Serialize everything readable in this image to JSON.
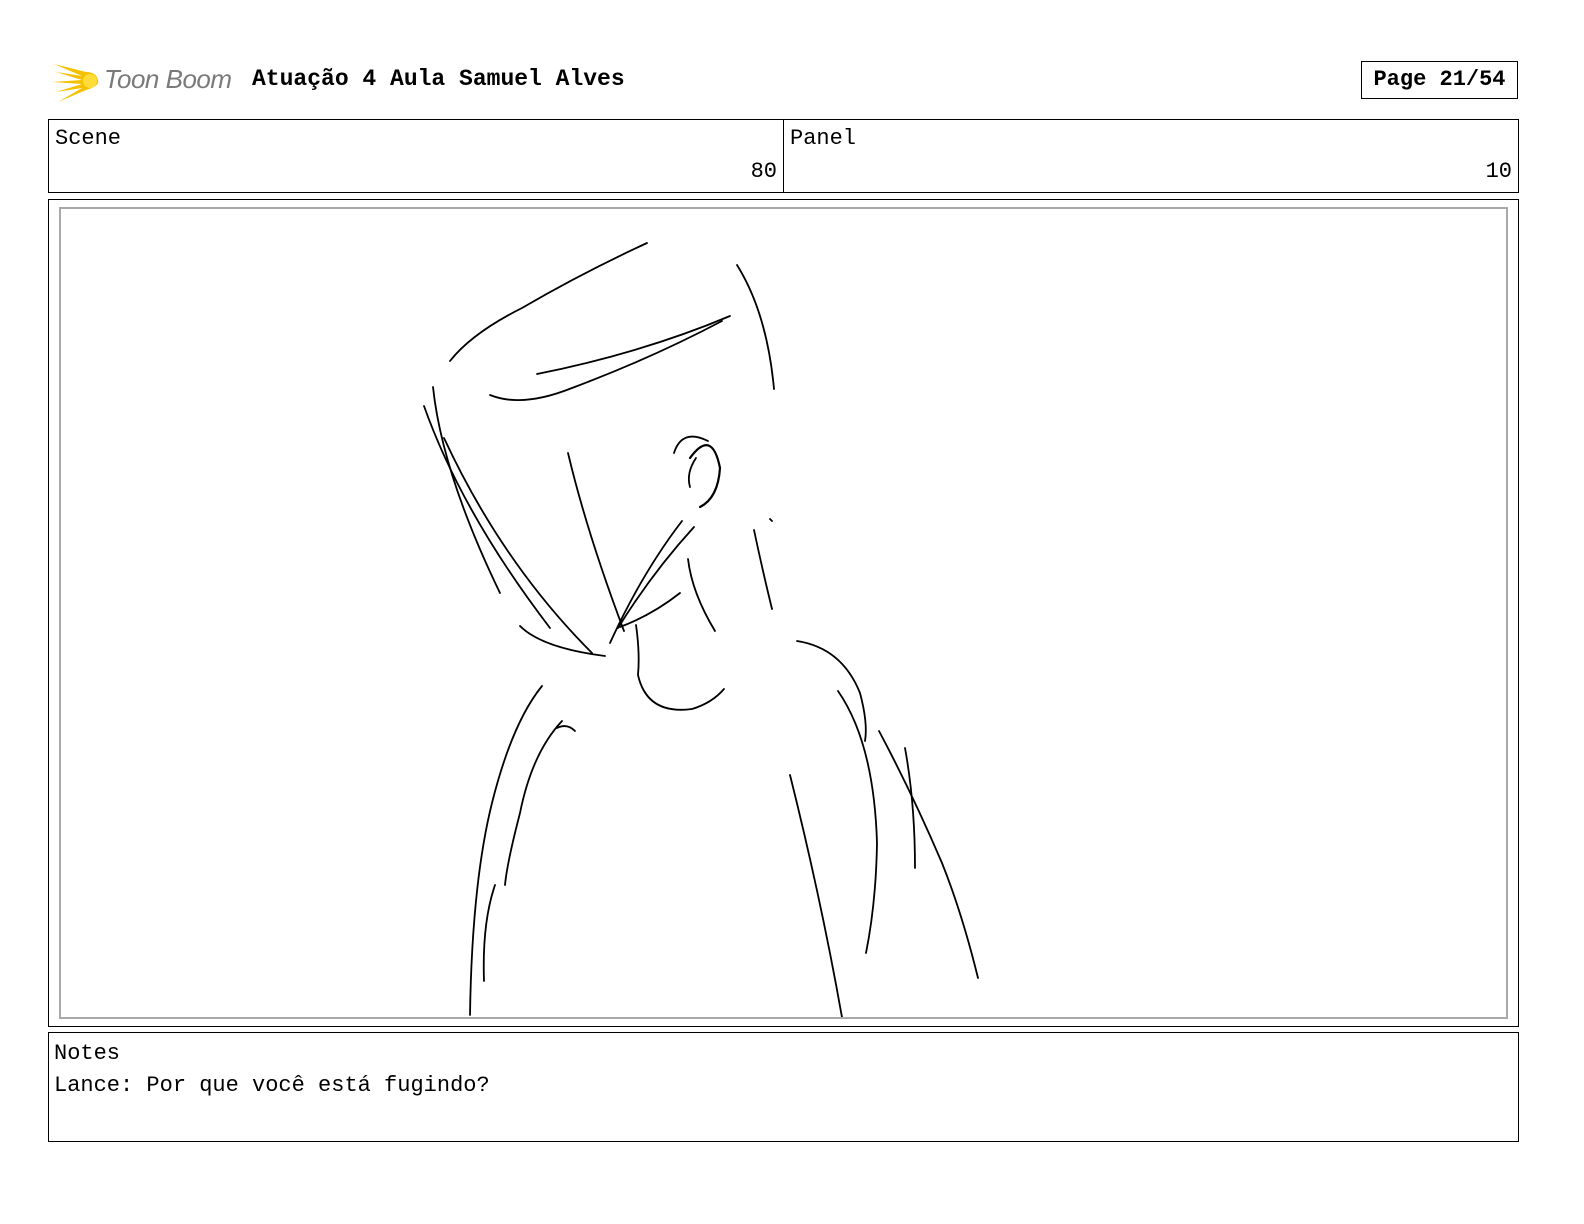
{
  "header": {
    "logo_text": "Toon Boom",
    "logo_icon": "toon-boom-burst-icon",
    "title": "Atuação 4 Aula Samuel Alves",
    "page_indicator": "Page 21/54"
  },
  "info": {
    "scene_label": "Scene",
    "scene_value": "80",
    "panel_label": "Panel",
    "panel_value": "10"
  },
  "panel": {
    "content": "sketch-drawing",
    "frame_color": "#a9a9a9"
  },
  "notes": {
    "label": "Notes",
    "text": "Lance: Por que você está fugindo?"
  },
  "colors": {
    "logo_accent": "#f5c000",
    "logo_text": "#7a7a7a",
    "ink": "#000000"
  }
}
